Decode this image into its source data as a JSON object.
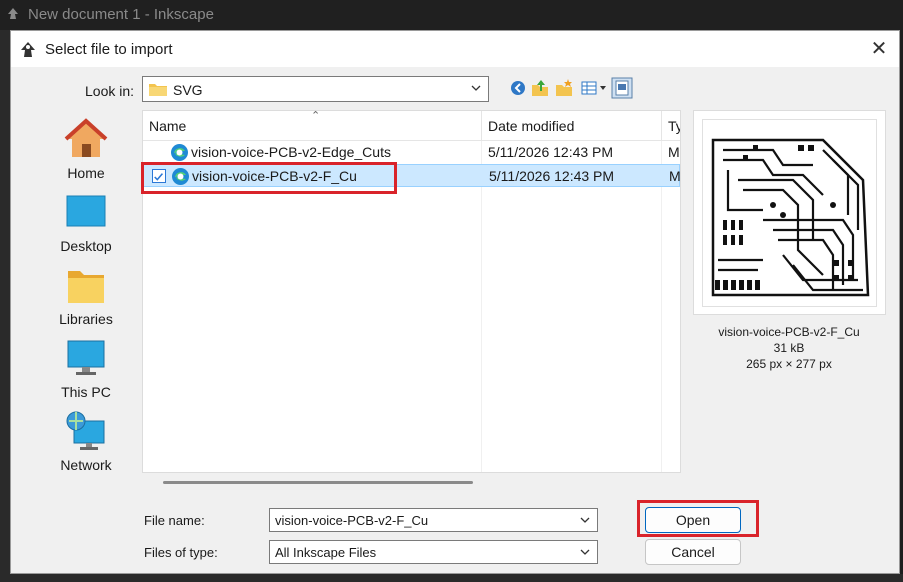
{
  "app": {
    "window_title": "New document 1 - Inkscape"
  },
  "dialog": {
    "title": "Select file to import",
    "close_label": "✕"
  },
  "look_in": {
    "label": "Look in:",
    "value": "SVG"
  },
  "places": [
    {
      "label": "Home",
      "icon": "home-icon"
    },
    {
      "label": "Desktop",
      "icon": "desktop-icon"
    },
    {
      "label": "Libraries",
      "icon": "libraries-icon"
    },
    {
      "label": "This PC",
      "icon": "this-pc-icon"
    },
    {
      "label": "Network",
      "icon": "network-icon"
    }
  ],
  "columns": {
    "name": "Name",
    "date": "Date modified",
    "type": "Ty"
  },
  "files": [
    {
      "name": "vision-voice-PCB-v2-Edge_Cuts",
      "date": "5/11/2026 12:43 PM",
      "type": "M",
      "selected": false
    },
    {
      "name": "vision-voice-PCB-v2-F_Cu",
      "date": "5/11/2026 12:43 PM",
      "type": "M",
      "selected": true
    }
  ],
  "preview": {
    "name": "vision-voice-PCB-v2-F_Cu",
    "size": "31 kB",
    "dimensions": "265 px × 277 px"
  },
  "file_name": {
    "label": "File name:",
    "value": "vision-voice-PCB-v2-F_Cu"
  },
  "file_type": {
    "label": "Files of type:",
    "value": "All Inkscape Files"
  },
  "buttons": {
    "open": "Open",
    "cancel": "Cancel"
  },
  "colors": {
    "selection": "#cce8ff",
    "highlight": "#d9232a",
    "accent": "#0067c0"
  }
}
